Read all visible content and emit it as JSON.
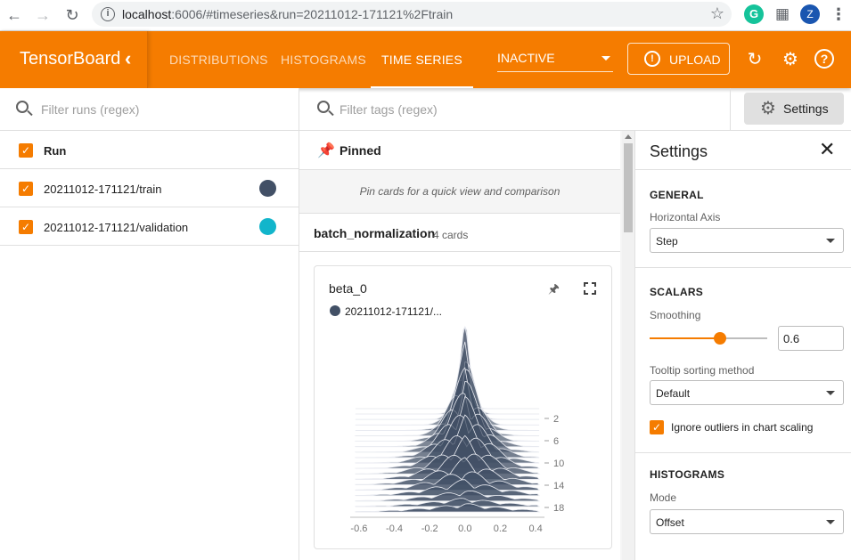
{
  "browser": {
    "url_host": "localhost",
    "url_rest": ":6006/#timeseries&run=20211012-171121%2Ftrain",
    "profile_initial": "Z",
    "grammarly_initial": "G"
  },
  "header": {
    "brand": "TensorBoard",
    "tabs": [
      {
        "label": "DISTRIBUTIONS"
      },
      {
        "label": "HISTOGRAMS"
      },
      {
        "label": "TIME SERIES"
      }
    ],
    "plugin_select": "INACTIVE",
    "upload_label": "UPLOAD"
  },
  "runs": {
    "filter_placeholder": "Filter runs (regex)",
    "column_label": "Run",
    "items": [
      {
        "label": "20211012-171121/train",
        "color": "#425066"
      },
      {
        "label": "20211012-171121/validation",
        "color": "#12b5cb"
      }
    ]
  },
  "main": {
    "tags_filter_placeholder": "Filter tags (regex)",
    "settings_button": "Settings",
    "pinned_title": "Pinned",
    "pinned_empty": "Pin cards for a quick view and comparison",
    "group_name": "batch_normalization",
    "group_count": "4 cards",
    "card": {
      "title": "beta_0",
      "legend": "20211012-171121/...",
      "x_ticks": [
        "-0.6",
        "-0.4",
        "-0.2",
        "0.0",
        "0.2",
        "0.4"
      ],
      "y_ticks": [
        "2",
        "6",
        "10",
        "14",
        "18"
      ]
    }
  },
  "settings": {
    "title": "Settings",
    "general_title": "GENERAL",
    "horizontal_axis_label": "Horizontal Axis",
    "horizontal_axis_value": "Step",
    "scalars_title": "SCALARS",
    "smoothing_label": "Smoothing",
    "smoothing_value": "0.6",
    "smoothing_fraction": 0.6,
    "tooltip_label": "Tooltip sorting method",
    "tooltip_value": "Default",
    "ignore_outliers_label": "Ignore outliers in chart scaling",
    "histograms_title": "HISTOGRAMS",
    "mode_label": "Mode",
    "mode_value": "Offset"
  },
  "colors": {
    "accent": "#f57c00",
    "run_train": "#425066",
    "run_validation": "#12b5cb"
  }
}
